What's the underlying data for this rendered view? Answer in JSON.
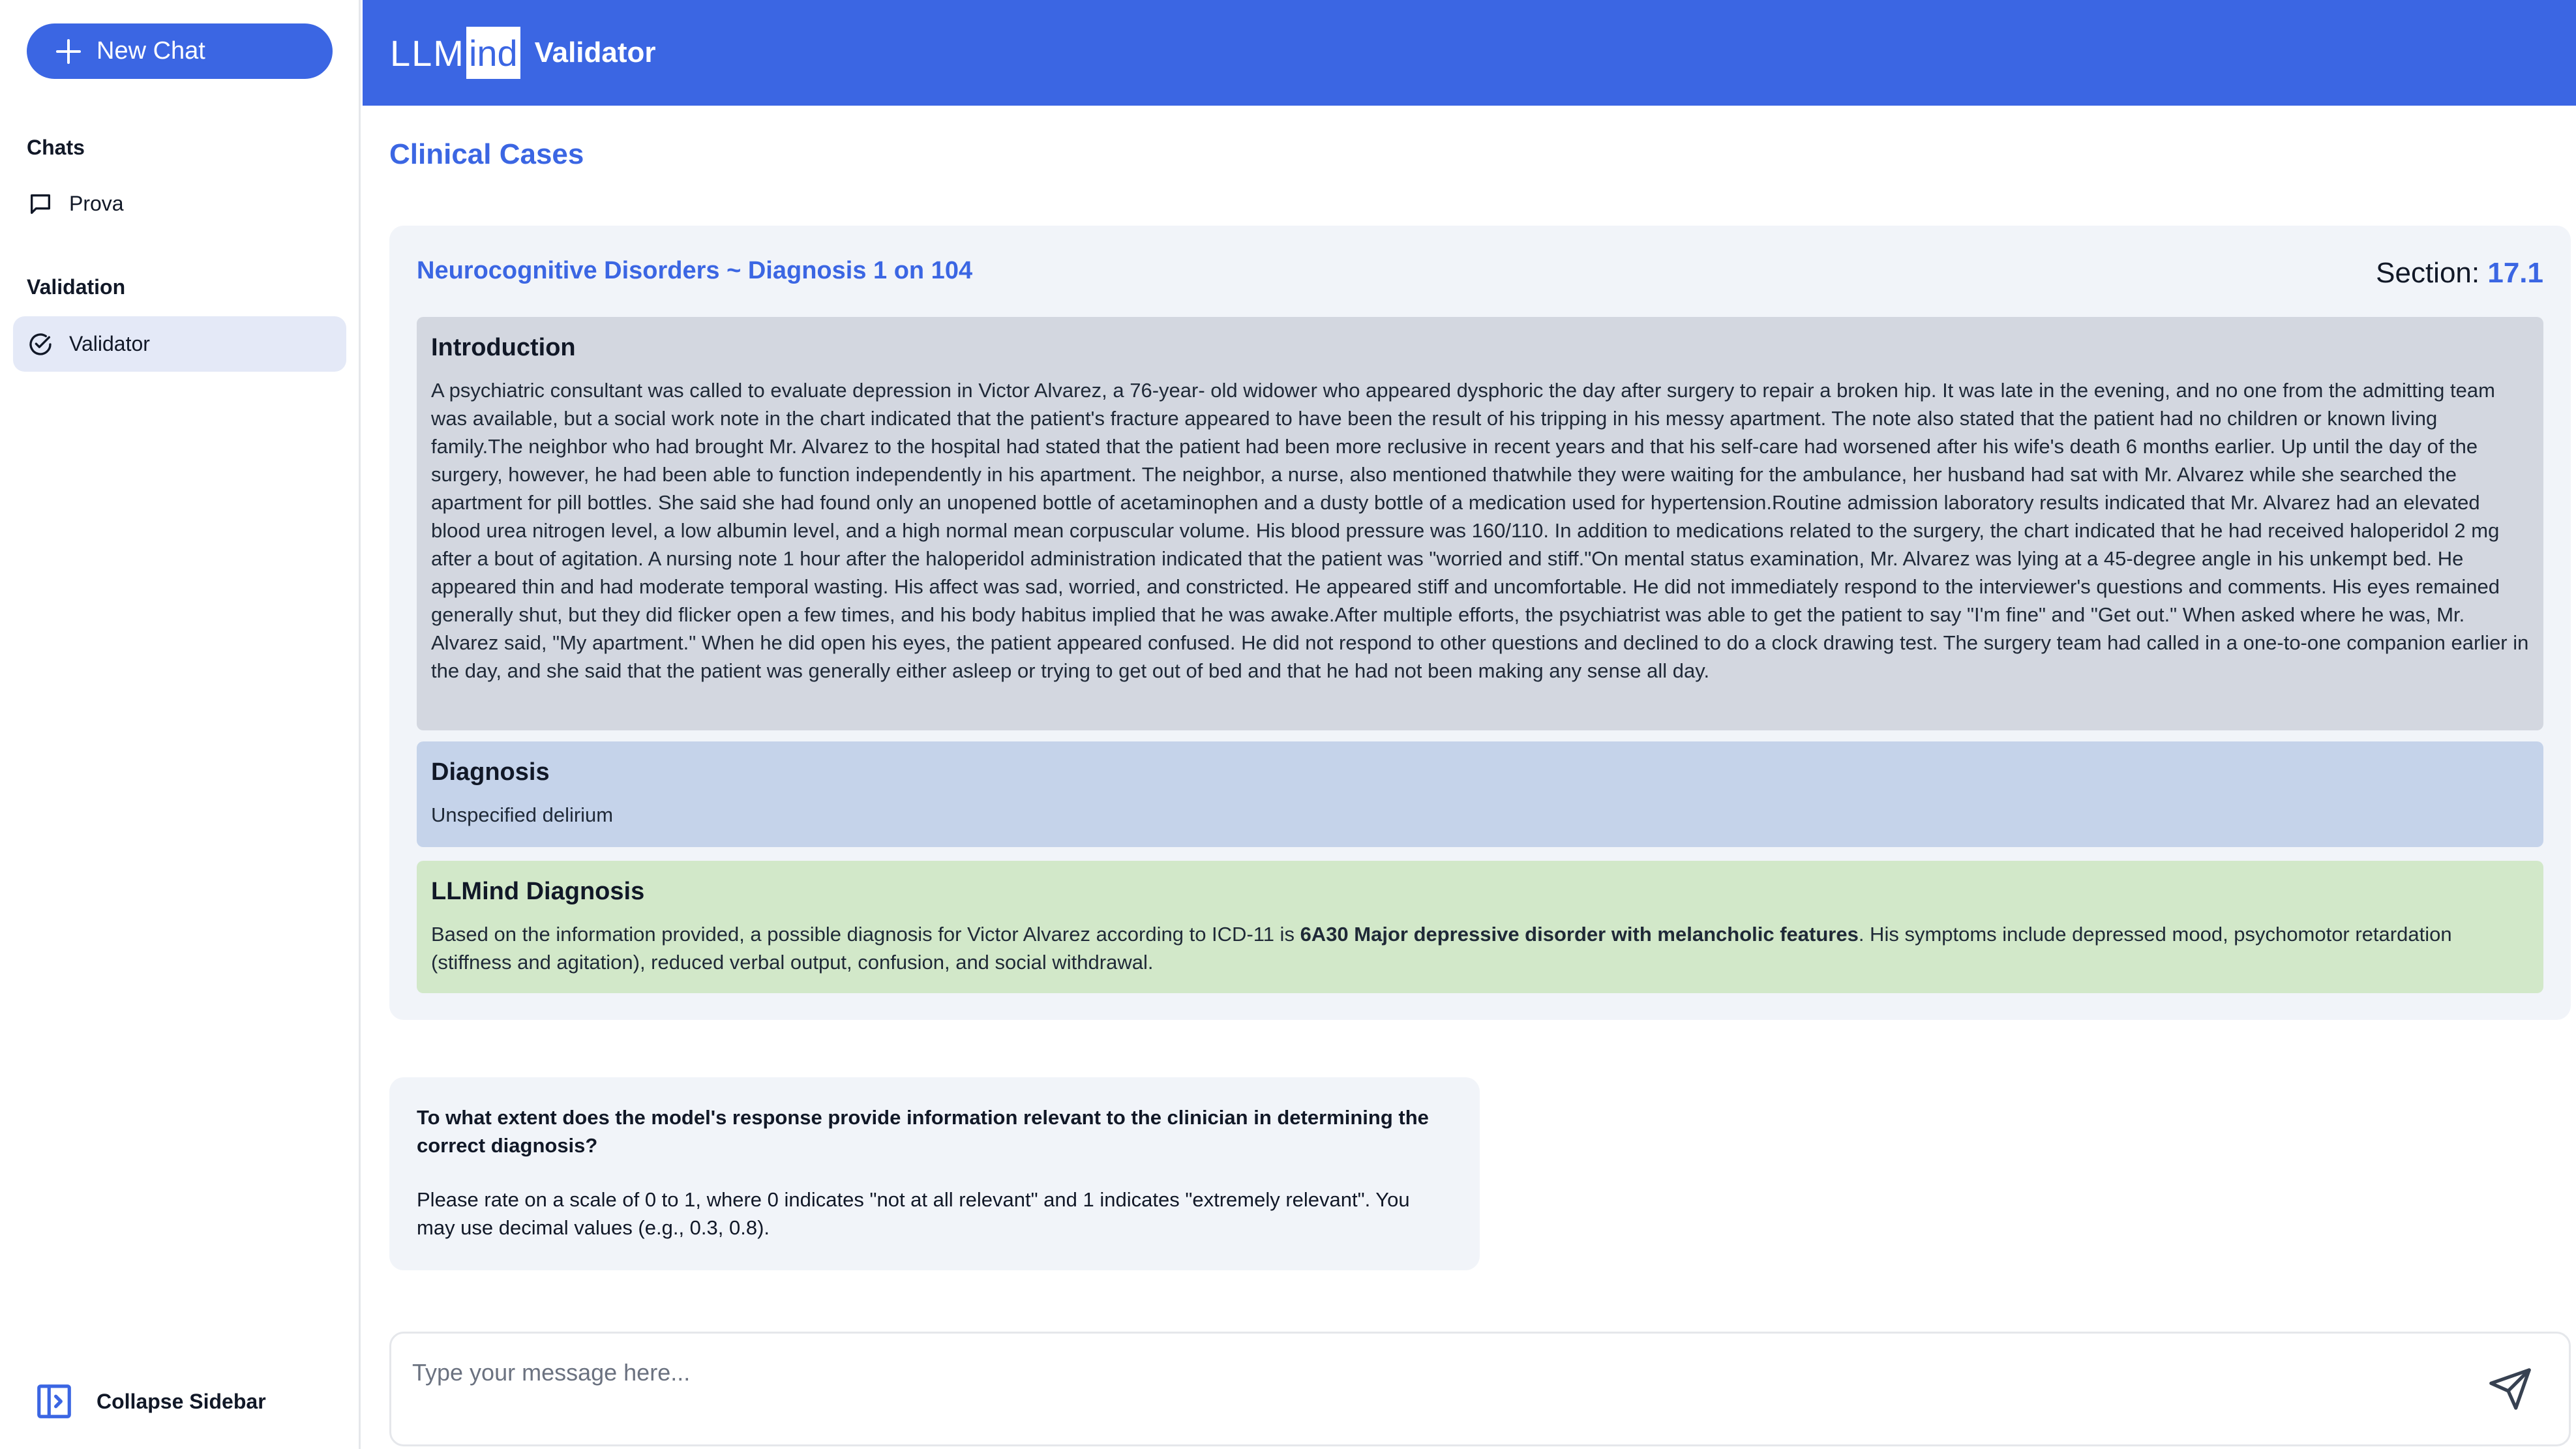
{
  "sidebar": {
    "new_chat_label": "New Chat",
    "chats_heading": "Chats",
    "chats": [
      {
        "label": "Prova"
      }
    ],
    "validation_heading": "Validation",
    "validation_items": [
      {
        "label": "Validator"
      }
    ],
    "collapse_label": "Collapse Sidebar"
  },
  "header": {
    "logo_left": "LLM",
    "logo_right": "ind",
    "title": "Validator"
  },
  "main": {
    "page_title": "Clinical Cases",
    "case": {
      "title": "Neurocognitive Disorders ~ Diagnosis 1 on 104",
      "section_label": "Section:",
      "section_number": "17.1",
      "introduction_heading": "Introduction",
      "introduction_text": "A psychiatric consultant was called to evaluate depression in Victor Alvarez, a 76-year- old widower who appeared dysphoric the day after surgery to repair a broken hip. It was late in the evening, and no one from the admitting team was available, but a social work note in the chart indicated that the patient's fracture appeared to have been the result of his tripping in his messy apartment. The note also stated that the patient had no children or known living family.The neighbor who had brought Mr. Alvarez to the hospital had stated that the patient had been more reclusive in recent years and that his self-care had worsened after his wife's death 6 months earlier. Up until the day of the surgery, however, he had been able to function independently in his apartment. The neighbor, a nurse, also mentioned thatwhile they were waiting for the ambulance, her husband had sat with Mr. Alvarez while she searched the apartment for pill bottles. She said she had found only an unopened bottle of acetaminophen and a dusty bottle of a medication used for hypertension.Routine admission laboratory results indicated that Mr. Alvarez had an elevated blood urea nitrogen level, a low albumin level, and a high normal mean corpuscular volume. His blood pressure was 160/110. In addition to medications related to the surgery, the chart indicated that he had received haloperidol 2 mg after a bout of agitation. A nursing note 1 hour after the haloperidol administration indicated that the patient was \"worried and stiff.\"On mental status examination, Mr. Alvarez was lying at a 45-degree angle in his unkempt bed. He appeared thin and had moderate temporal wasting. His affect was sad, worried, and constricted. He appeared stiff and uncomfortable. He did not immediately respond to the interviewer's questions and comments. His eyes remained generally shut, but they did flicker open a few times, and his body habitus implied that he was awake.After multiple efforts, the psychiatrist was able to get the patient to say \"I'm fine\" and \"Get out.\" When asked where he was, Mr. Alvarez said, \"My apartment.\" When he did open his eyes, the patient appeared confused. He did not respond to other questions and declined to do a clock drawing test. The surgery team had called in a one-to-one companion earlier in the day, and she said that the patient was generally either asleep or trying to get out of bed and that he had not been making any sense all day.",
      "diagnosis_heading": "Diagnosis",
      "diagnosis_text": "Unspecified delirium",
      "llmind_heading": "LLMind Diagnosis",
      "llmind_text_before": "Based on the information provided, a possible diagnosis for Victor Alvarez according to ICD-11 is ",
      "llmind_text_bold": "6A30 Major depressive disorder with melancholic features",
      "llmind_text_after": ". His symptoms include depressed mood, psychomotor retardation (stiffness and agitation), reduced verbal output, confusion, and social withdrawal."
    },
    "question": {
      "text": "To what extent does the model's response provide information relevant to the clinician in determining the correct diagnosis?",
      "instructions": "Please rate on a scale of 0 to 1, where 0 indicates \"not at all relevant\" and 1 indicates \"extremely relevant\". You may use decimal values (e.g., 0.3, 0.8)."
    },
    "input": {
      "placeholder": "Type your message here...",
      "value": ""
    }
  },
  "icons": {
    "new_chat": "plus-icon",
    "chat": "chat-bubble-icon",
    "validator": "check-circle-icon",
    "collapse": "sidebar-collapse-icon",
    "send": "send-icon"
  },
  "colors": {
    "accent": "#3b66e3",
    "intro_bg": "#d3d7e0",
    "diagnosis_bg": "#c5d3ea",
    "llmind_bg": "#d2e8c9",
    "card_bg": "#f1f4f9",
    "active_item_bg": "#e4e9f7"
  }
}
